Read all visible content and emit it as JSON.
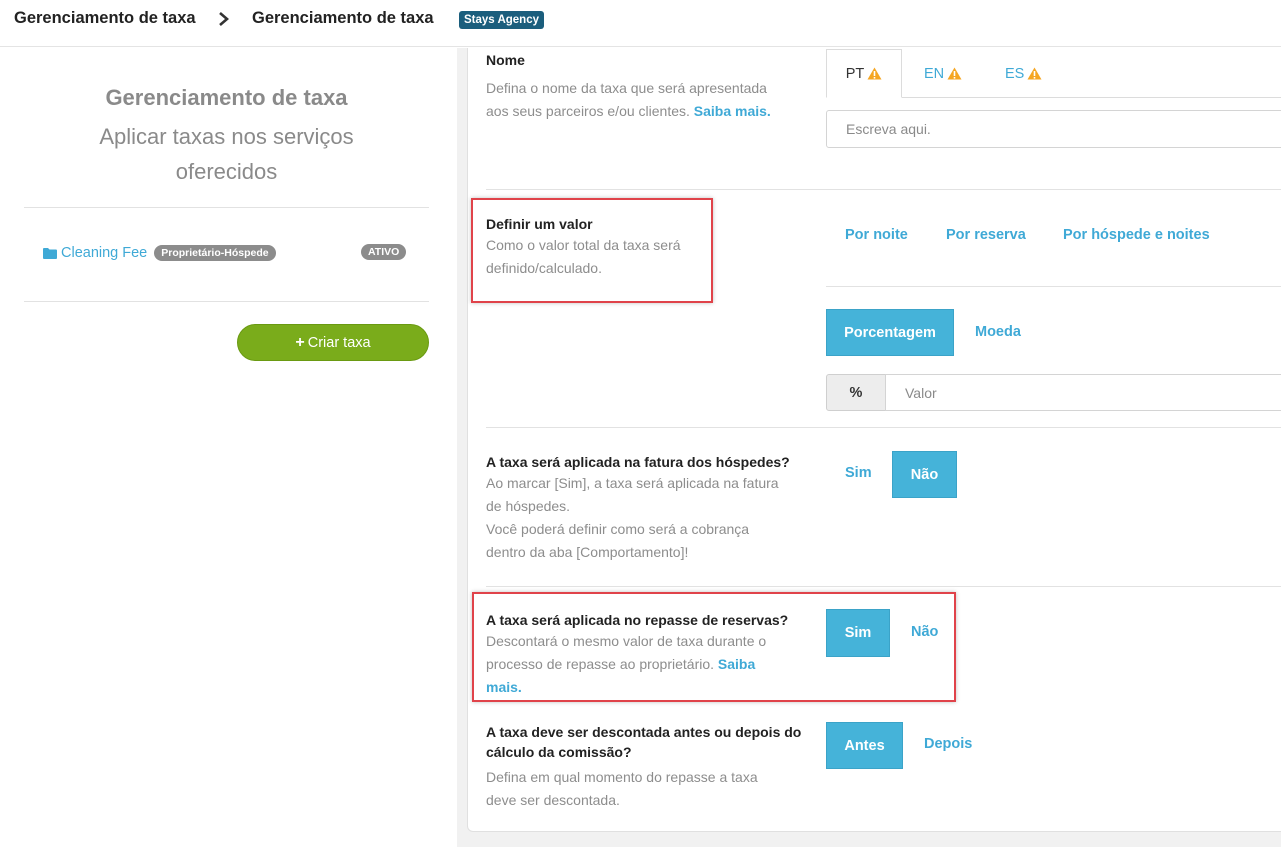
{
  "breadcrumb": {
    "first": "Gerenciamento de taxa",
    "second": "Gerenciamento de taxa",
    "badge": "Stays Agency"
  },
  "sidebar": {
    "title": "Gerenciamento de taxa",
    "subtitle_line1": "Aplicar taxas nos serviços",
    "subtitle_line2": "oferecidos",
    "fee": {
      "name": "Cleaning Fee",
      "tag": "Proprietário-Hóspede",
      "status": "ATIVO"
    },
    "create_button": "Criar taxa"
  },
  "form": {
    "name_section": {
      "title": "Nome",
      "desc_line1": "Defina o nome da taxa que será apresentada",
      "desc_line2": "aos seus parceiros e/ou clientes.",
      "link": "Saiba mais.",
      "tabs": [
        "PT",
        "EN",
        "ES"
      ],
      "input_placeholder": "Escreva aqui."
    },
    "value_section": {
      "title": "Definir um valor",
      "desc_line1": "Como o valor total da taxa será",
      "desc_line2": "definido/calculado.",
      "options": [
        "Por noite",
        "Por reserva",
        "Por hóspede e noites"
      ],
      "type_selected": "Porcentagem",
      "type_other": "Moeda",
      "addon": "%",
      "value_placeholder": "Valor"
    },
    "invoice_section": {
      "title": "A taxa será aplicada na fatura dos hóspedes?",
      "desc_line1": "Ao marcar [Sim], a taxa será aplicada na fatura",
      "desc_line2": "de hóspedes.",
      "desc_line3": "Você poderá definir como será a cobrança",
      "desc_line4": "dentro da aba [Comportamento]!",
      "yes": "Sim",
      "no": "Não",
      "selected": "Não"
    },
    "transfer_section": {
      "title": "A taxa será aplicada no repasse de reservas?",
      "desc_line1": "Descontará o mesmo valor de taxa durante o",
      "desc_line2": "processo de repasse ao proprietário.",
      "link_part1": "Saiba",
      "link_part2": "mais.",
      "yes": "Sim",
      "no": "Não",
      "selected": "Sim"
    },
    "commission_section": {
      "title_line1": "A taxa deve ser descontada antes ou depois do",
      "title_line2": "cálculo da comissão?",
      "desc_line1": "Defina em qual momento do repasse a taxa",
      "desc_line2": "deve ser descontada.",
      "before": "Antes",
      "after": "Depois",
      "selected": "Antes"
    }
  },
  "colors": {
    "accent": "#45b3d9",
    "link": "#3fa9d6",
    "create_button": "#7aac1b",
    "warning": "#f5a623",
    "highlight_box": "#e0434a",
    "badge": "#1b5e7d"
  }
}
